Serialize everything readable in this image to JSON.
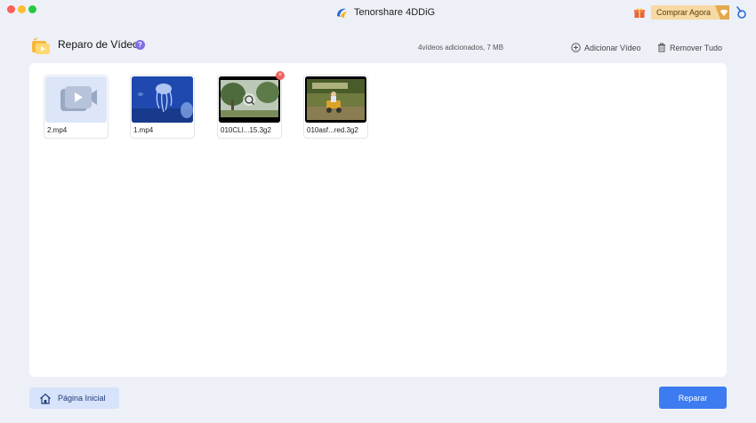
{
  "window": {
    "app_title": "Tenorshare 4DDiG",
    "buy_button": "Comprar Agora"
  },
  "header": {
    "title": "Reparo de Vídeo",
    "help_glyph": "?",
    "summary": "4vídeos adicionados,   7 MB",
    "add_video": "Adicionar Vídeo",
    "remove_all": "Remover Tudo"
  },
  "videos": [
    {
      "filename": "2.mp4"
    },
    {
      "filename": "1.mp4"
    },
    {
      "filename": "010CLI...15.3g2",
      "close_glyph": "×"
    },
    {
      "filename": "010asf...red.3g2"
    }
  ],
  "footer": {
    "home_button": "Página Inicial",
    "repair_button": "Reparar"
  },
  "colors": {
    "primary": "#3c7bf0",
    "background": "#eef0f7",
    "buy_button_bg": "#f7d9a3",
    "close_badge": "#f0625d"
  },
  "icons": [
    "close-window-icon",
    "minimize-window-icon",
    "zoom-window-icon",
    "app-logo-icon",
    "gift-icon",
    "diamond-icon",
    "user-icon",
    "video-repair-icon",
    "help-icon",
    "add-circle-icon",
    "trash-icon",
    "video-placeholder-icon",
    "zoom-preview-icon",
    "home-icon"
  ]
}
